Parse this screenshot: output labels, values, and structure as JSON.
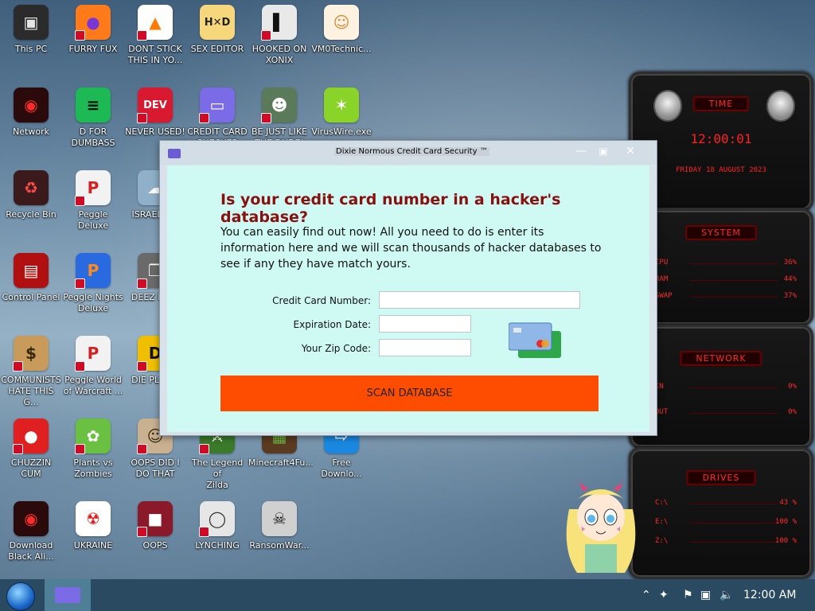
{
  "desktop_icons": [
    {
      "name": "this-pc",
      "label": "This PC",
      "bg": "#2b2b2b",
      "glyph": "▣",
      "fg": "#e5e5e5",
      "col": 0,
      "row": 0,
      "shortcut": false
    },
    {
      "name": "furry-fux",
      "label": "FURRY FUX",
      "bg": "#ff7b1a",
      "glyph": "●",
      "fg": "#7a35d6",
      "col": 1,
      "row": 0,
      "shortcut": true
    },
    {
      "name": "dont-stick",
      "label": "DONT STICK\nTHIS IN YO...",
      "bg": "#ffffff",
      "glyph": "▲",
      "fg": "#ff7a00",
      "col": 2,
      "row": 0,
      "shortcut": true
    },
    {
      "name": "sex-editor",
      "label": "SEX EDITOR",
      "bg": "#f6d77b",
      "glyph": "H✕D",
      "fg": "#222",
      "col": 3,
      "row": 0,
      "shortcut": false
    },
    {
      "name": "hooked-on-xonix",
      "label": "HOOKED ON\nXONIX",
      "bg": "#e9e9e9",
      "glyph": "▌",
      "fg": "#111",
      "col": 4,
      "row": 0,
      "shortcut": true
    },
    {
      "name": "vm0technic",
      "label": "VM0Technic...",
      "bg": "#fff2e0",
      "glyph": "☺",
      "fg": "#d88a33",
      "col": 5,
      "row": 0,
      "shortcut": false
    },
    {
      "name": "network",
      "label": "Network",
      "bg": "#2a0a0a",
      "glyph": "◉",
      "fg": "#ff2a2a",
      "col": 0,
      "row": 1,
      "shortcut": false
    },
    {
      "name": "d-for-dumbass",
      "label": "D FOR\nDUMBASS",
      "bg": "#1db954",
      "glyph": "≡",
      "fg": "#111",
      "col": 1,
      "row": 1,
      "shortcut": false
    },
    {
      "name": "never-used",
      "label": "NEVER USED!",
      "bg": "#d8192f",
      "glyph": "DEV",
      "fg": "#fff",
      "col": 2,
      "row": 1,
      "shortcut": true
    },
    {
      "name": "credit-card-checker",
      "label": "CREDIT CARD\nCHECKER",
      "bg": "#7b6be6",
      "glyph": "▭",
      "fg": "#fff",
      "col": 3,
      "row": 1,
      "shortcut": true
    },
    {
      "name": "be-just-like-the-dude",
      "label": "BE JUST LIKE\nTHE DUDE!",
      "bg": "#5a7a5a",
      "glyph": "☻",
      "fg": "#fff",
      "col": 4,
      "row": 1,
      "shortcut": true
    },
    {
      "name": "viruswire",
      "label": "VirusWire.exe",
      "bg": "#8ad42a",
      "glyph": "✶",
      "fg": "#fff",
      "col": 5,
      "row": 1,
      "shortcut": false
    },
    {
      "name": "recycle-bin",
      "label": "Recycle Bin",
      "bg": "#3a1a1a",
      "glyph": "♻",
      "fg": "#ff4a4a",
      "col": 0,
      "row": 2,
      "shortcut": false
    },
    {
      "name": "peggle-deluxe",
      "label": "Peggle Deluxe",
      "bg": "#f2f2f2",
      "glyph": "P",
      "fg": "#d82020",
      "col": 1,
      "row": 2,
      "shortcut": true
    },
    {
      "name": "israel",
      "label": "ISRAEL S...",
      "bg": "#8fb0c8",
      "glyph": "☁",
      "fg": "#fff",
      "col": 2,
      "row": 2,
      "shortcut": false
    },
    {
      "name": "control-panel",
      "label": "Control Panel",
      "bg": "#b01010",
      "glyph": "▤",
      "fg": "#fff",
      "col": 0,
      "row": 3,
      "shortcut": false
    },
    {
      "name": "peggle-nights-deluxe",
      "label": "Peggle Nights\nDeluxe",
      "bg": "#2a6ae0",
      "glyph": "P",
      "fg": "#ff8a1a",
      "col": 1,
      "row": 3,
      "shortcut": true
    },
    {
      "name": "deez-nuts",
      "label": "DEEZ NU...",
      "bg": "#6a6a6a",
      "glyph": "❐",
      "fg": "#fff",
      "col": 2,
      "row": 3,
      "shortcut": true
    },
    {
      "name": "communists",
      "label": "COMMUNISTS\nHATE THIS G...",
      "bg": "#c89b5a",
      "glyph": "$",
      "fg": "#3a2a10",
      "col": 0,
      "row": 4,
      "shortcut": true
    },
    {
      "name": "peggle-world-of-warcraft",
      "label": "Peggle World\nof Warcraft ...",
      "bg": "#f2f2f2",
      "glyph": "P",
      "fg": "#d82020",
      "col": 1,
      "row": 4,
      "shortcut": true
    },
    {
      "name": "die-please",
      "label": "DIE PLEA...",
      "bg": "#f0c000",
      "glyph": "D",
      "fg": "#111",
      "col": 2,
      "row": 4,
      "shortcut": true
    },
    {
      "name": "chuzzin-cum",
      "label": "CHUZZIN\nCUM",
      "bg": "#e02020",
      "glyph": "●",
      "fg": "#fff",
      "col": 0,
      "row": 5,
      "shortcut": true
    },
    {
      "name": "plants-vs-zombies",
      "label": "Plants vs\nZombies",
      "bg": "#6ac040",
      "glyph": "✿",
      "fg": "#fff",
      "col": 1,
      "row": 5,
      "shortcut": true
    },
    {
      "name": "oops-did-i-do-that",
      "label": "OOPS DID I\nDO THAT",
      "bg": "#c8b090",
      "glyph": "☺",
      "fg": "#3a2a10",
      "col": 2,
      "row": 5,
      "shortcut": true
    },
    {
      "name": "legend-of-zilda",
      "label": "The Legend of\nZilda",
      "bg": "#3a7a2a",
      "glyph": "⚔",
      "fg": "#fff",
      "col": 3,
      "row": 5,
      "shortcut": true
    },
    {
      "name": "minecraft4fun",
      "label": "Minecraft4Fu...",
      "bg": "#5a3a20",
      "glyph": "▦",
      "fg": "#6ac040",
      "col": 4,
      "row": 5,
      "shortcut": false
    },
    {
      "name": "free-download",
      "label": "Free\nDownlo...",
      "bg": "#1a88e0",
      "glyph": "⇨",
      "fg": "#fff",
      "col": 5,
      "row": 5,
      "shortcut": false
    },
    {
      "name": "download-black-ali",
      "label": "Download\nBlack Ali...",
      "bg": "#2a0a0a",
      "glyph": "◉",
      "fg": "#ff2a2a",
      "col": 0,
      "row": 6,
      "shortcut": false
    },
    {
      "name": "ukraine",
      "label": "UKRAINE",
      "bg": "#ffffff",
      "glyph": "☢",
      "fg": "#e01a1a",
      "col": 1,
      "row": 6,
      "shortcut": false
    },
    {
      "name": "oops",
      "label": "OOPS",
      "bg": "#8a1a2a",
      "glyph": "■",
      "fg": "#fff",
      "col": 2,
      "row": 6,
      "shortcut": true
    },
    {
      "name": "lynching",
      "label": "LYNCHING",
      "bg": "#e6e6e6",
      "glyph": "◯",
      "fg": "#333",
      "col": 3,
      "row": 6,
      "shortcut": true
    },
    {
      "name": "ransomware",
      "label": "RansomWar...",
      "bg": "#d0d0d0",
      "glyph": "☠",
      "fg": "#111",
      "col": 4,
      "row": 6,
      "shortcut": false
    }
  ],
  "gadget": {
    "time_title": "TIME",
    "time_value": "12:00:01",
    "date_value": "FRIDAY 18 AUGUST 2023",
    "system_title": "SYSTEM",
    "system_rows": [
      {
        "label": "CPU",
        "value": "36%"
      },
      {
        "label": "RAM",
        "value": "44%"
      },
      {
        "label": "SWAP",
        "value": "37%"
      }
    ],
    "network_title": "NETWORK",
    "network_rows": [
      {
        "label": "IN",
        "value": "0%"
      },
      {
        "label": "OUT",
        "value": "0%"
      }
    ],
    "drives_title": "DRIVES",
    "drive_rows": [
      {
        "label": "C:\\",
        "value": "43 %"
      },
      {
        "label": "E:\\",
        "value": "100 %"
      },
      {
        "label": "Z:\\",
        "value": "100 %"
      }
    ]
  },
  "window": {
    "title": "Dixie Normous Credit Card Security ™",
    "minimize_label": "—",
    "maximize_label": "▣",
    "close_label": "✕",
    "headline": "Is your credit card number in a hacker's database?",
    "description": "You can easily find out now! All you need to do is enter its information here and we will scan thousands of hacker databases to see if any they have match yours.",
    "fields": {
      "card_label": "Credit Card Number:",
      "card_value": "",
      "exp_label": "Expiration Date:",
      "exp_value": "",
      "zip_label": "Your Zip Code:",
      "zip_value": ""
    },
    "scan_button": "SCAN DATABASE"
  },
  "taskbar": {
    "clock": "12:00 AM",
    "tray_icons": [
      "chevron-up",
      "bird-tray",
      "flag",
      "network-tray",
      "volume"
    ]
  },
  "colors": {
    "accent": "#ff4d00",
    "headline": "#8a1010",
    "gadget_red": "#ff2a2a",
    "panel_bg": "#cffaf4"
  }
}
